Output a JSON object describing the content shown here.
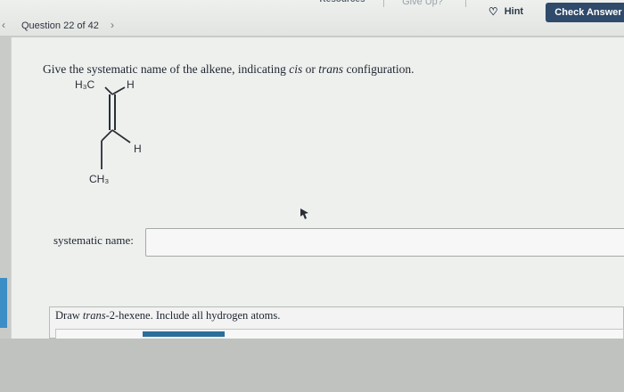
{
  "toolbar": {
    "resources_label": "Resources",
    "giveup_label": "Give Up?",
    "hint_label": "Hint",
    "check_label": "Check Answer"
  },
  "nav": {
    "prev_icon": "chevron-left-icon",
    "question_counter": "Question 22 of 42",
    "next_icon": "chevron-right-icon"
  },
  "question": {
    "prefix": "Give the systematic name of the alkene, indicating ",
    "cis": "cis",
    "or": " or ",
    "trans": "trans",
    "suffix": " configuration."
  },
  "structure": {
    "top_left": "H₃C",
    "top_right": "H",
    "bottom_right": "H",
    "bottom_left": "CH₃"
  },
  "answer": {
    "label": "systematic name:",
    "value": ""
  },
  "draw_prompt": {
    "prefix": "Draw ",
    "italic": "trans",
    "suffix": "-2-hexene. Include all hydrogen atoms."
  },
  "colors": {
    "check_button": "#2f4a6a",
    "progress_bar": "#2b6f9a",
    "side_tab": "#3c8ec6"
  }
}
